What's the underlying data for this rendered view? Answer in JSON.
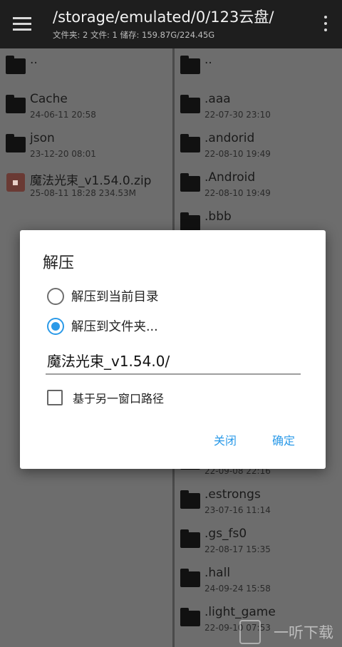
{
  "app_bar": {
    "menu_icon": "hamburger-menu-icon",
    "path": "/storage/emulated/0/123云盘/",
    "info": "文件夹: 2  文件: 1  储存: 159.87G/224.45G",
    "more_icon": "overflow-menu-icon"
  },
  "left_pane": {
    "items": [
      {
        "name": "..",
        "meta": "",
        "icon": "folder-icon"
      },
      {
        "name": "Cache",
        "meta": "24-06-11 20:58",
        "icon": "folder-icon"
      },
      {
        "name": "json",
        "meta": "23-12-20 08:01",
        "icon": "folder-icon"
      },
      {
        "name": "魔法光束_v1.54.0.zip",
        "meta": "25-08-11 18:28  234.53M",
        "icon": "zip-file-icon"
      }
    ]
  },
  "right_pane": {
    "items_top": [
      {
        "name": "..",
        "meta": "",
        "icon": "folder-icon"
      },
      {
        "name": ".aaa",
        "meta": "22-07-30 23:10",
        "icon": "folder-icon"
      },
      {
        "name": ".andorid",
        "meta": "22-08-10 19:49",
        "icon": "folder-icon"
      },
      {
        "name": ".Android",
        "meta": "22-08-10 19:49",
        "icon": "folder-icon"
      },
      {
        "name": ".bbb",
        "meta": "",
        "icon": "folder-icon"
      }
    ],
    "items_bottom": [
      {
        "name": "",
        "meta": "22-09-08 22:16",
        "icon": "folder-icon"
      },
      {
        "name": ".estrongs",
        "meta": "23-07-16 11:14",
        "icon": "folder-icon"
      },
      {
        "name": ".gs_fs0",
        "meta": "22-08-17 15:35",
        "icon": "folder-icon"
      },
      {
        "name": ".hall",
        "meta": "24-09-24 15:58",
        "icon": "folder-icon"
      },
      {
        "name": ".light_game",
        "meta": "22-09-10 07:53",
        "icon": "folder-icon"
      }
    ]
  },
  "dialog": {
    "title": "解压",
    "options": [
      {
        "label": "解压到当前目录",
        "selected": false
      },
      {
        "label": "解压到文件夹...",
        "selected": true
      }
    ],
    "folder_value": "魔法光束_v1.54.0/",
    "checkbox_label": "基于另一窗口路径",
    "checkbox_checked": false,
    "cancel_label": "关闭",
    "confirm_label": "确定",
    "accent_color": "#2b9ae8"
  },
  "watermark": {
    "text": "一听下载"
  }
}
